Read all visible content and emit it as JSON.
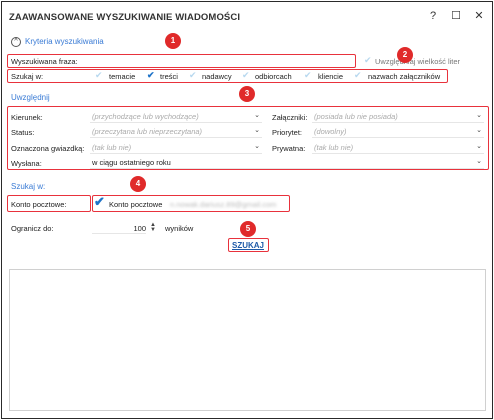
{
  "window": {
    "title": "ZAAWANSOWANE WYSZUKIWANIE WIADOMOŚCI",
    "help_glyph": "?",
    "maximize_glyph": "☐",
    "close_glyph": "✕"
  },
  "criteria": {
    "header": "Kryteria wyszukiwania",
    "collapse_glyph": "^",
    "phrase_label": "Wyszukiwana fraza:",
    "phrase_value": "",
    "case_label": "Uwzględniaj wielkość liter",
    "case_checked": false,
    "search_in_label": "Szukaj w:",
    "search_in": [
      {
        "label": "temacie",
        "checked": false
      },
      {
        "label": "treści",
        "checked": true
      },
      {
        "label": "nadawcy",
        "checked": false
      },
      {
        "label": "odbiorcach",
        "checked": false
      },
      {
        "label": "kliencie",
        "checked": false
      },
      {
        "label": "nazwach załączników",
        "checked": false
      }
    ]
  },
  "include": {
    "header": "Uwzględnij",
    "direction_label": "Kierunek:",
    "direction_placeholder": "(przychodzące lub wychodzące)",
    "attachments_label": "Załączniki:",
    "attachments_placeholder": "(posiada lub nie posiada)",
    "status_label": "Status:",
    "status_placeholder": "(przeczytana lub nieprzeczytana)",
    "priority_label": "Priorytet:",
    "priority_placeholder": "(dowolny)",
    "flagged_label": "Oznaczona gwiazdką:",
    "flagged_placeholder": "(tak lub nie)",
    "private_label": "Prywatna:",
    "private_placeholder": "(tak lub nie)",
    "sent_label": "Wysłana:",
    "sent_value": "w ciągu ostatniego roku"
  },
  "search_in_section": {
    "header": "Szukaj w:",
    "mailbox_label": "Konto pocztowe:",
    "mailbox_value": "Konto pocztowe",
    "mailbox_email": "n.nowak.dariusz.89@gmail.com",
    "mailbox_checked": true
  },
  "limit": {
    "label": "Ogranicz do:",
    "value": "100",
    "suffix": "wyników"
  },
  "search_button": "SZUKAJ",
  "annotations": [
    "1",
    "2",
    "3",
    "4",
    "5"
  ],
  "colors": {
    "accent": "#3a7bd5",
    "annotation_red": "#e8323c",
    "check_on": "#1e73c8",
    "check_off": "#b7d8ef"
  },
  "icons": {
    "check": "✔",
    "caret": "⌄",
    "stepper_up": "▲",
    "stepper_down": "▼"
  }
}
